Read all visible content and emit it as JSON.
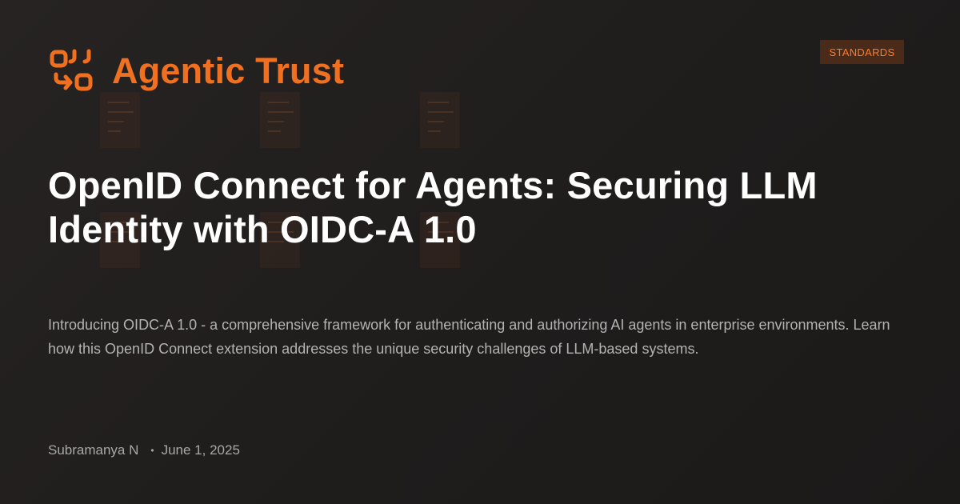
{
  "brand": {
    "name": "Agentic Trust",
    "icon": "agentic-trust-logo-icon",
    "color": "#f07020"
  },
  "category_badge": "STANDARDS",
  "article": {
    "title": "OpenID Connect for Agents: Securing LLM Identity with OIDC-A 1.0",
    "description": "Introducing OIDC-A 1.0 - a comprehensive framework for authenticating and authorizing AI agents in enterprise environments. Learn how this OpenID Connect extension addresses the unique security challenges of LLM-based systems.",
    "author": "Subramanya N",
    "separator": "•",
    "date": "June 1, 2025"
  },
  "colors": {
    "background": "#221f1e",
    "accent": "#f07020",
    "badge_background": "#4a2a18",
    "title_text": "#ffffff",
    "body_text": "#b3b3b3"
  }
}
